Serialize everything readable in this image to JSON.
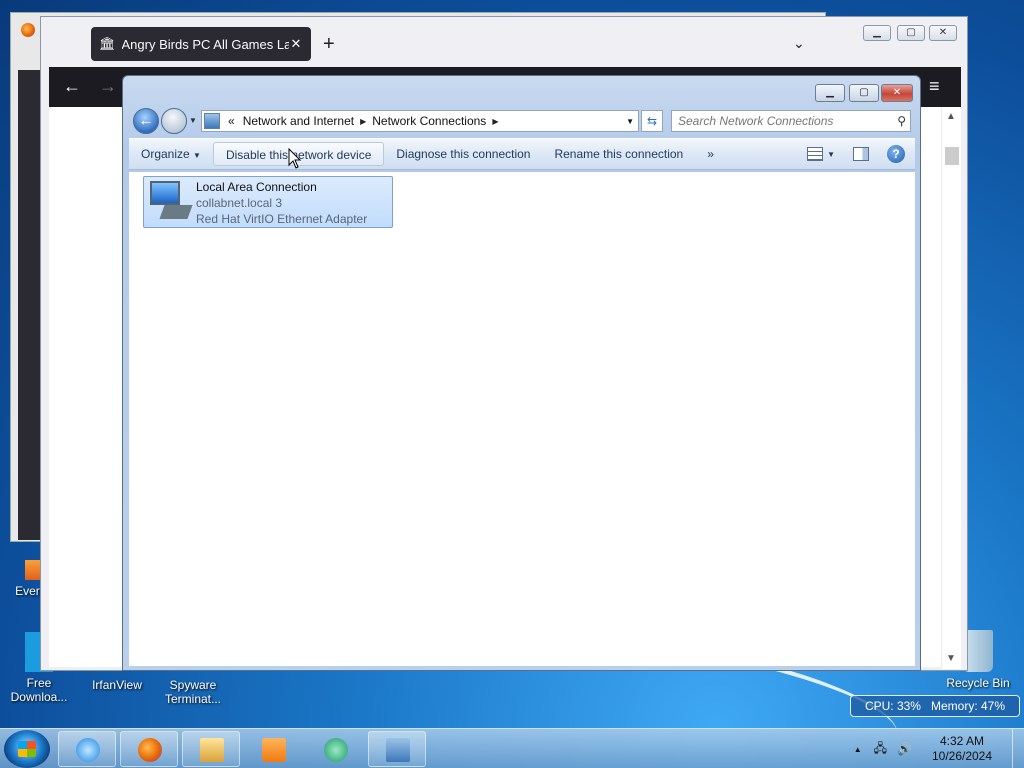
{
  "desktop": {
    "icons": [
      {
        "label": "Every...",
        "id": "every"
      },
      {
        "label": "Free\nDownloa...",
        "id": "free-download"
      },
      {
        "label": "IrfanView",
        "id": "irfanview"
      },
      {
        "label": "Spyware\nTerminat...",
        "id": "spyware-terminator"
      },
      {
        "label": "Recycle Bin",
        "id": "recycle-bin"
      }
    ],
    "gadget": {
      "cpu": "CPU: 33%",
      "memory": "Memory: 47%"
    }
  },
  "firefox": {
    "tab_title": "Angry Birds PC All Games Latest",
    "new_tab": "+",
    "list_all_tabs": "⌄",
    "back": "←",
    "forward": "→",
    "menu": "≡"
  },
  "explorer": {
    "breadcrumb": {
      "overflow": "«",
      "segments": [
        "Network and Internet",
        "Network Connections"
      ]
    },
    "search_placeholder": "Search Network Connections",
    "toolbar": {
      "organize": "Organize",
      "disable": "Disable this network device",
      "diagnose": "Diagnose this connection",
      "rename": "Rename this connection",
      "more": "»"
    },
    "connection": {
      "name": "Local Area Connection",
      "network": "collabnet.local  3",
      "adapter": "Red Hat VirtIO Ethernet Adapter"
    }
  },
  "taskbar": {
    "time": "4:32 AM",
    "date": "10/26/2024",
    "apps": [
      "internet-explorer",
      "firefox",
      "windows-explorer",
      "media-player",
      "media-center",
      "network-connections"
    ]
  }
}
